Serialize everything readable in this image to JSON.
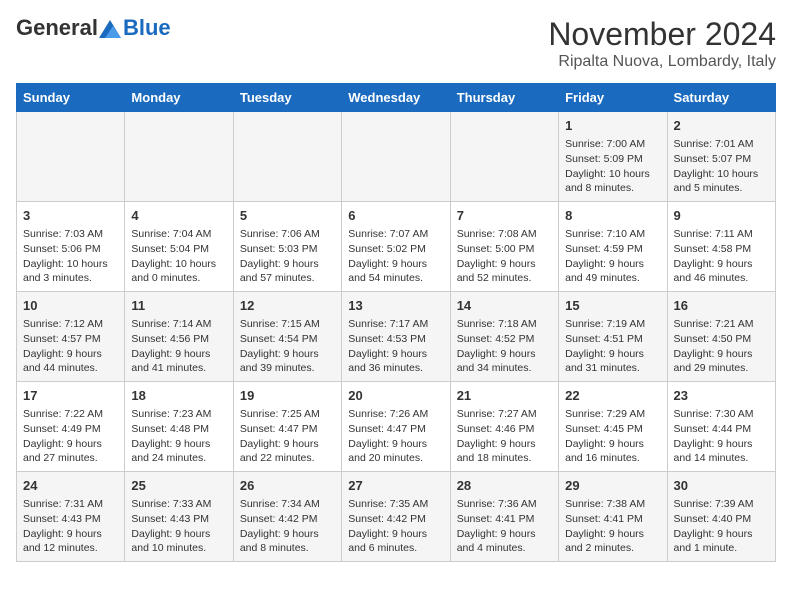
{
  "header": {
    "logo_line1": "General",
    "logo_line2": "Blue",
    "month_title": "November 2024",
    "location": "Ripalta Nuova, Lombardy, Italy"
  },
  "days_of_week": [
    "Sunday",
    "Monday",
    "Tuesday",
    "Wednesday",
    "Thursday",
    "Friday",
    "Saturday"
  ],
  "weeks": [
    [
      {
        "day": "",
        "info": ""
      },
      {
        "day": "",
        "info": ""
      },
      {
        "day": "",
        "info": ""
      },
      {
        "day": "",
        "info": ""
      },
      {
        "day": "",
        "info": ""
      },
      {
        "day": "1",
        "info": "Sunrise: 7:00 AM\nSunset: 5:09 PM\nDaylight: 10 hours and 8 minutes."
      },
      {
        "day": "2",
        "info": "Sunrise: 7:01 AM\nSunset: 5:07 PM\nDaylight: 10 hours and 5 minutes."
      }
    ],
    [
      {
        "day": "3",
        "info": "Sunrise: 7:03 AM\nSunset: 5:06 PM\nDaylight: 10 hours and 3 minutes."
      },
      {
        "day": "4",
        "info": "Sunrise: 7:04 AM\nSunset: 5:04 PM\nDaylight: 10 hours and 0 minutes."
      },
      {
        "day": "5",
        "info": "Sunrise: 7:06 AM\nSunset: 5:03 PM\nDaylight: 9 hours and 57 minutes."
      },
      {
        "day": "6",
        "info": "Sunrise: 7:07 AM\nSunset: 5:02 PM\nDaylight: 9 hours and 54 minutes."
      },
      {
        "day": "7",
        "info": "Sunrise: 7:08 AM\nSunset: 5:00 PM\nDaylight: 9 hours and 52 minutes."
      },
      {
        "day": "8",
        "info": "Sunrise: 7:10 AM\nSunset: 4:59 PM\nDaylight: 9 hours and 49 minutes."
      },
      {
        "day": "9",
        "info": "Sunrise: 7:11 AM\nSunset: 4:58 PM\nDaylight: 9 hours and 46 minutes."
      }
    ],
    [
      {
        "day": "10",
        "info": "Sunrise: 7:12 AM\nSunset: 4:57 PM\nDaylight: 9 hours and 44 minutes."
      },
      {
        "day": "11",
        "info": "Sunrise: 7:14 AM\nSunset: 4:56 PM\nDaylight: 9 hours and 41 minutes."
      },
      {
        "day": "12",
        "info": "Sunrise: 7:15 AM\nSunset: 4:54 PM\nDaylight: 9 hours and 39 minutes."
      },
      {
        "day": "13",
        "info": "Sunrise: 7:17 AM\nSunset: 4:53 PM\nDaylight: 9 hours and 36 minutes."
      },
      {
        "day": "14",
        "info": "Sunrise: 7:18 AM\nSunset: 4:52 PM\nDaylight: 9 hours and 34 minutes."
      },
      {
        "day": "15",
        "info": "Sunrise: 7:19 AM\nSunset: 4:51 PM\nDaylight: 9 hours and 31 minutes."
      },
      {
        "day": "16",
        "info": "Sunrise: 7:21 AM\nSunset: 4:50 PM\nDaylight: 9 hours and 29 minutes."
      }
    ],
    [
      {
        "day": "17",
        "info": "Sunrise: 7:22 AM\nSunset: 4:49 PM\nDaylight: 9 hours and 27 minutes."
      },
      {
        "day": "18",
        "info": "Sunrise: 7:23 AM\nSunset: 4:48 PM\nDaylight: 9 hours and 24 minutes."
      },
      {
        "day": "19",
        "info": "Sunrise: 7:25 AM\nSunset: 4:47 PM\nDaylight: 9 hours and 22 minutes."
      },
      {
        "day": "20",
        "info": "Sunrise: 7:26 AM\nSunset: 4:47 PM\nDaylight: 9 hours and 20 minutes."
      },
      {
        "day": "21",
        "info": "Sunrise: 7:27 AM\nSunset: 4:46 PM\nDaylight: 9 hours and 18 minutes."
      },
      {
        "day": "22",
        "info": "Sunrise: 7:29 AM\nSunset: 4:45 PM\nDaylight: 9 hours and 16 minutes."
      },
      {
        "day": "23",
        "info": "Sunrise: 7:30 AM\nSunset: 4:44 PM\nDaylight: 9 hours and 14 minutes."
      }
    ],
    [
      {
        "day": "24",
        "info": "Sunrise: 7:31 AM\nSunset: 4:43 PM\nDaylight: 9 hours and 12 minutes."
      },
      {
        "day": "25",
        "info": "Sunrise: 7:33 AM\nSunset: 4:43 PM\nDaylight: 9 hours and 10 minutes."
      },
      {
        "day": "26",
        "info": "Sunrise: 7:34 AM\nSunset: 4:42 PM\nDaylight: 9 hours and 8 minutes."
      },
      {
        "day": "27",
        "info": "Sunrise: 7:35 AM\nSunset: 4:42 PM\nDaylight: 9 hours and 6 minutes."
      },
      {
        "day": "28",
        "info": "Sunrise: 7:36 AM\nSunset: 4:41 PM\nDaylight: 9 hours and 4 minutes."
      },
      {
        "day": "29",
        "info": "Sunrise: 7:38 AM\nSunset: 4:41 PM\nDaylight: 9 hours and 2 minutes."
      },
      {
        "day": "30",
        "info": "Sunrise: 7:39 AM\nSunset: 4:40 PM\nDaylight: 9 hours and 1 minute."
      }
    ]
  ]
}
